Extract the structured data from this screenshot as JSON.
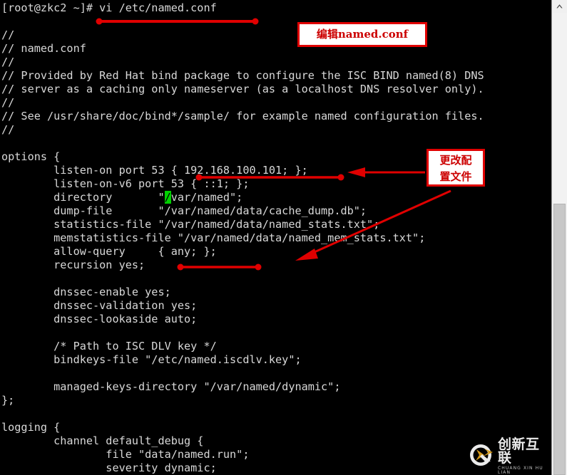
{
  "terminal": {
    "prompt_line": "[root@zkc2 ~]# vi /etc/named.conf",
    "lines": [
      "[root@zkc2 ~]# vi /etc/named.conf",
      "",
      "//",
      "// named.conf",
      "//",
      "// Provided by Red Hat bind package to configure the ISC BIND named(8) DNS",
      "// server as a caching only nameserver (as a localhost DNS resolver only).",
      "//",
      "// See /usr/share/doc/bind*/sample/ for example named configuration files.",
      "//",
      "",
      "options {",
      "        listen-on port 53 { 192.168.100.101; };",
      "        listen-on-v6 port 53 { ::1; };",
      "        directory       \"/var/named\";",
      "        dump-file       \"/var/named/data/cache_dump.db\";",
      "        statistics-file \"/var/named/data/named_stats.txt\";",
      "        memstatistics-file \"/var/named/data/named_mem_stats.txt\";",
      "        allow-query     { any; };",
      "        recursion yes;",
      "",
      "        dnssec-enable yes;",
      "        dnssec-validation yes;",
      "        dnssec-lookaside auto;",
      "",
      "        /* Path to ISC DLV key */",
      "        bindkeys-file \"/etc/named.iscdlv.key\";",
      "",
      "        managed-keys-directory \"/var/named/dynamic\";",
      "};",
      "",
      "logging {",
      "        channel default_debug {",
      "                file \"data/named.run\";",
      "                severity dynamic;"
    ],
    "cursor": {
      "line_index": 14,
      "char": "/",
      "color": "#00d100"
    },
    "text_color": "#d8d8d8",
    "background_color": "#000000"
  },
  "annotations": {
    "accent_color": "#e00000",
    "box1": {
      "text": "编辑named.conf"
    },
    "box2": {
      "line1": "更改配",
      "line2": "置文件"
    }
  },
  "scrollbar": {
    "up_arrow_icon": "chevron-up-icon",
    "thumb_color": "#c8c8c8",
    "track_color": "#f0f0f0"
  },
  "watermark": {
    "cn": "创新互联",
    "en": "CHUANG XIN HU LIAN",
    "logo": "cx-logo-icon"
  }
}
